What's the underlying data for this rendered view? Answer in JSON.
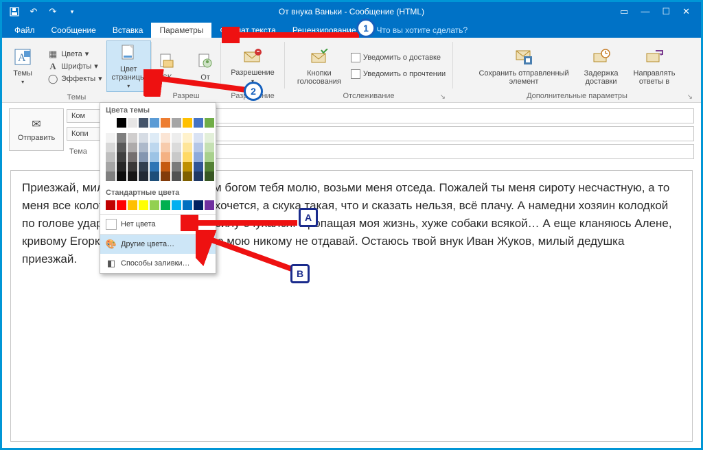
{
  "titlebar": {
    "title": "От внука Ваньки - Сообщение (HTML)"
  },
  "tabs": {
    "file": "Файл",
    "message": "Сообщение",
    "insert": "Вставка",
    "options": "Параметры",
    "format": "Формат текста",
    "review": "Рецензирование",
    "tellme": "Что вы хотите сделать?"
  },
  "ribbon": {
    "themes": {
      "label": "Темы",
      "themes_btn": "Темы",
      "colors": "Цвета",
      "fonts": "Шрифты",
      "effects": "Эффекты",
      "page_color": "Цвет\nстраницы"
    },
    "fields": {
      "bcc": "СК",
      "from": "От",
      "legend_prefix": "Разреш"
    },
    "permission": {
      "label": "Разрешение",
      "btn": "Разрешение"
    },
    "tracking": {
      "label": "Отслеживание",
      "voting": "Кнопки\nголосования",
      "delivery": "Уведомить о доставке",
      "read": "Уведомить о прочтении"
    },
    "more": {
      "label": "Дополнительные параметры",
      "save_sent": "Сохранить отправленный\nэлемент",
      "delay": "Задержка\nдоставки",
      "direct_replies": "Направлять\nответы в"
    }
  },
  "compose": {
    "send": "Отправить",
    "to": "Ком",
    "cc": "Копи",
    "subject": "Тема"
  },
  "palette": {
    "theme_title": "Цвета темы",
    "standard_title": "Стандартные цвета",
    "no_color": "Нет цвета",
    "more_colors": "Другие цвета…",
    "fill_effects": "Способы заливки…",
    "theme_row0": [
      "#ffffff",
      "#000000",
      "#e7e6e6",
      "#44546a",
      "#5b9bd5",
      "#ed7d31",
      "#a5a5a5",
      "#ffc000",
      "#4472c4",
      "#70ad47"
    ],
    "theme_shades": [
      [
        "#f2f2f2",
        "#7f7f7f",
        "#d0cece",
        "#d6dce4",
        "#deebf6",
        "#fbe5d5",
        "#ededed",
        "#fff2cc",
        "#d9e2f3",
        "#e2efd9"
      ],
      [
        "#d8d8d8",
        "#595959",
        "#aeabab",
        "#adb9ca",
        "#bdd7ee",
        "#f7cbac",
        "#dbdbdb",
        "#fee599",
        "#b4c6e7",
        "#c5e0b3"
      ],
      [
        "#bfbfbf",
        "#3f3f3f",
        "#757070",
        "#8496b0",
        "#9cc3e5",
        "#f4b183",
        "#c9c9c9",
        "#ffd965",
        "#8eaadb",
        "#a8d08d"
      ],
      [
        "#a5a5a5",
        "#262626",
        "#3a3838",
        "#323f4f",
        "#2e75b5",
        "#c55a11",
        "#7b7b7b",
        "#bf9000",
        "#2f5496",
        "#538135"
      ],
      [
        "#7f7f7f",
        "#0c0c0c",
        "#171616",
        "#222a35",
        "#1e4e79",
        "#833c0b",
        "#525252",
        "#7f6000",
        "#1f3864",
        "#375623"
      ]
    ],
    "standard": [
      "#c00000",
      "#ff0000",
      "#ffc000",
      "#ffff00",
      "#92d050",
      "#00b050",
      "#00b0f0",
      "#0070c0",
      "#002060",
      "#7030a0"
    ]
  },
  "body_text": "Приезжай, милый дедушка, Христом богом тебя молю, возьми меня отседа. Пожалей ты меня сироту несчастную, а то меня все колотят и кушать страсть хочется, а скука такая, что и сказать нельзя, всё плачу. А намедни хозяин колодкой по голове ударил, так что упал и насилу очухался. Пропащая моя жизнь, хуже собаки всякой… А еще кланяюсь Алене, кривому Егорке и кучеру, а гармонию мою никому не отдавай. Остаюсь твой внук Иван Жуков, милый дедушка приезжай.",
  "annotations": {
    "b1": "1",
    "b2": "2",
    "bA": "A",
    "bB": "B"
  }
}
